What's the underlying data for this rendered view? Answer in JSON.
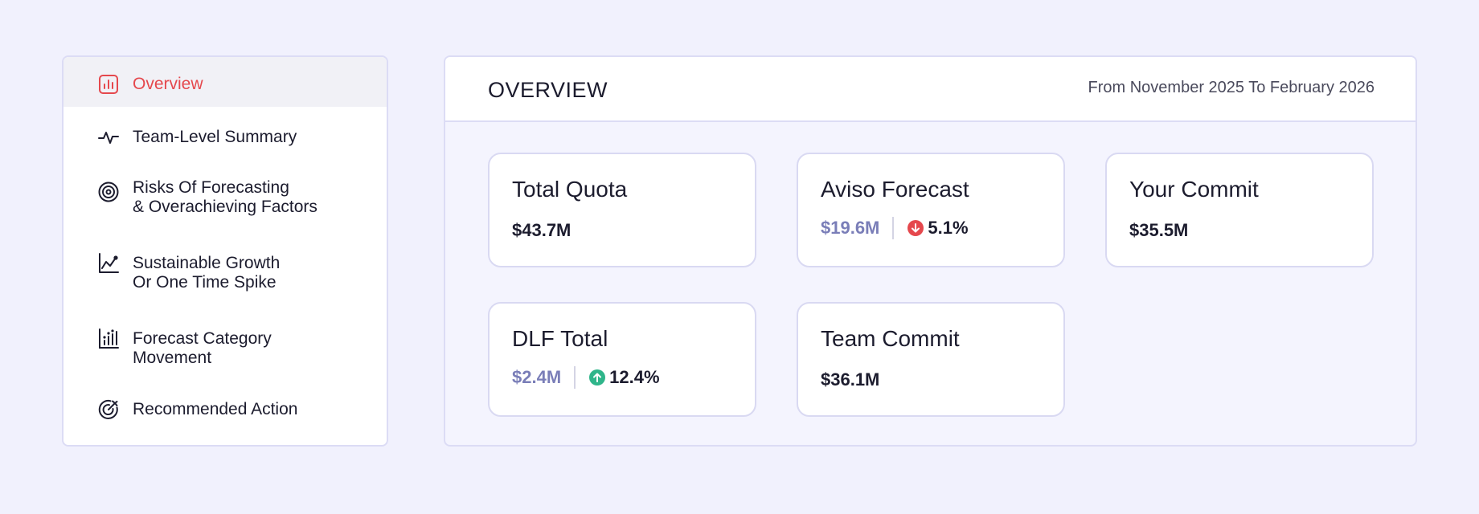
{
  "sidebar": {
    "items": [
      {
        "label": "Overview",
        "icon": "bar-chart-icon",
        "active": true
      },
      {
        "label": "Team-Level Summary",
        "icon": "activity-icon"
      },
      {
        "label": "Risks Of Forecasting\n& Overachieving Factors",
        "icon": "target-icon"
      },
      {
        "label": "Sustainable Growth\nOr One Time Spike",
        "icon": "trend-chart-icon"
      },
      {
        "label": "Forecast Category\nMovement",
        "icon": "dot-bar-chart-icon"
      },
      {
        "label": "Recommended Action",
        "icon": "target-arrow-icon"
      }
    ]
  },
  "main": {
    "title": "OVERVIEW",
    "date_range": "From November 2025 To February 2026",
    "cards": {
      "total_quota": {
        "title": "Total Quota",
        "value": "$43.7M"
      },
      "aviso_forecast": {
        "title": "Aviso Forecast",
        "value": "$19.6M",
        "change": "5.1%",
        "direction": "down",
        "direction_icon": "arrow-down-circle-icon"
      },
      "your_commit": {
        "title": "Your Commit",
        "value": "$35.5M"
      },
      "dlf_total": {
        "title": "DLF Total",
        "value": "$2.4M",
        "change": "12.4%",
        "direction": "up",
        "direction_icon": "arrow-up-circle-icon"
      },
      "team_commit": {
        "title": "Team Commit",
        "value": "$36.1M"
      }
    }
  },
  "colors": {
    "accent": "#e5484d",
    "down": "#e5484d",
    "up": "#2fb58a",
    "muted_value": "#7a7eb8",
    "page_bg": "#f1f1fd",
    "border": "#dcdcf5"
  }
}
